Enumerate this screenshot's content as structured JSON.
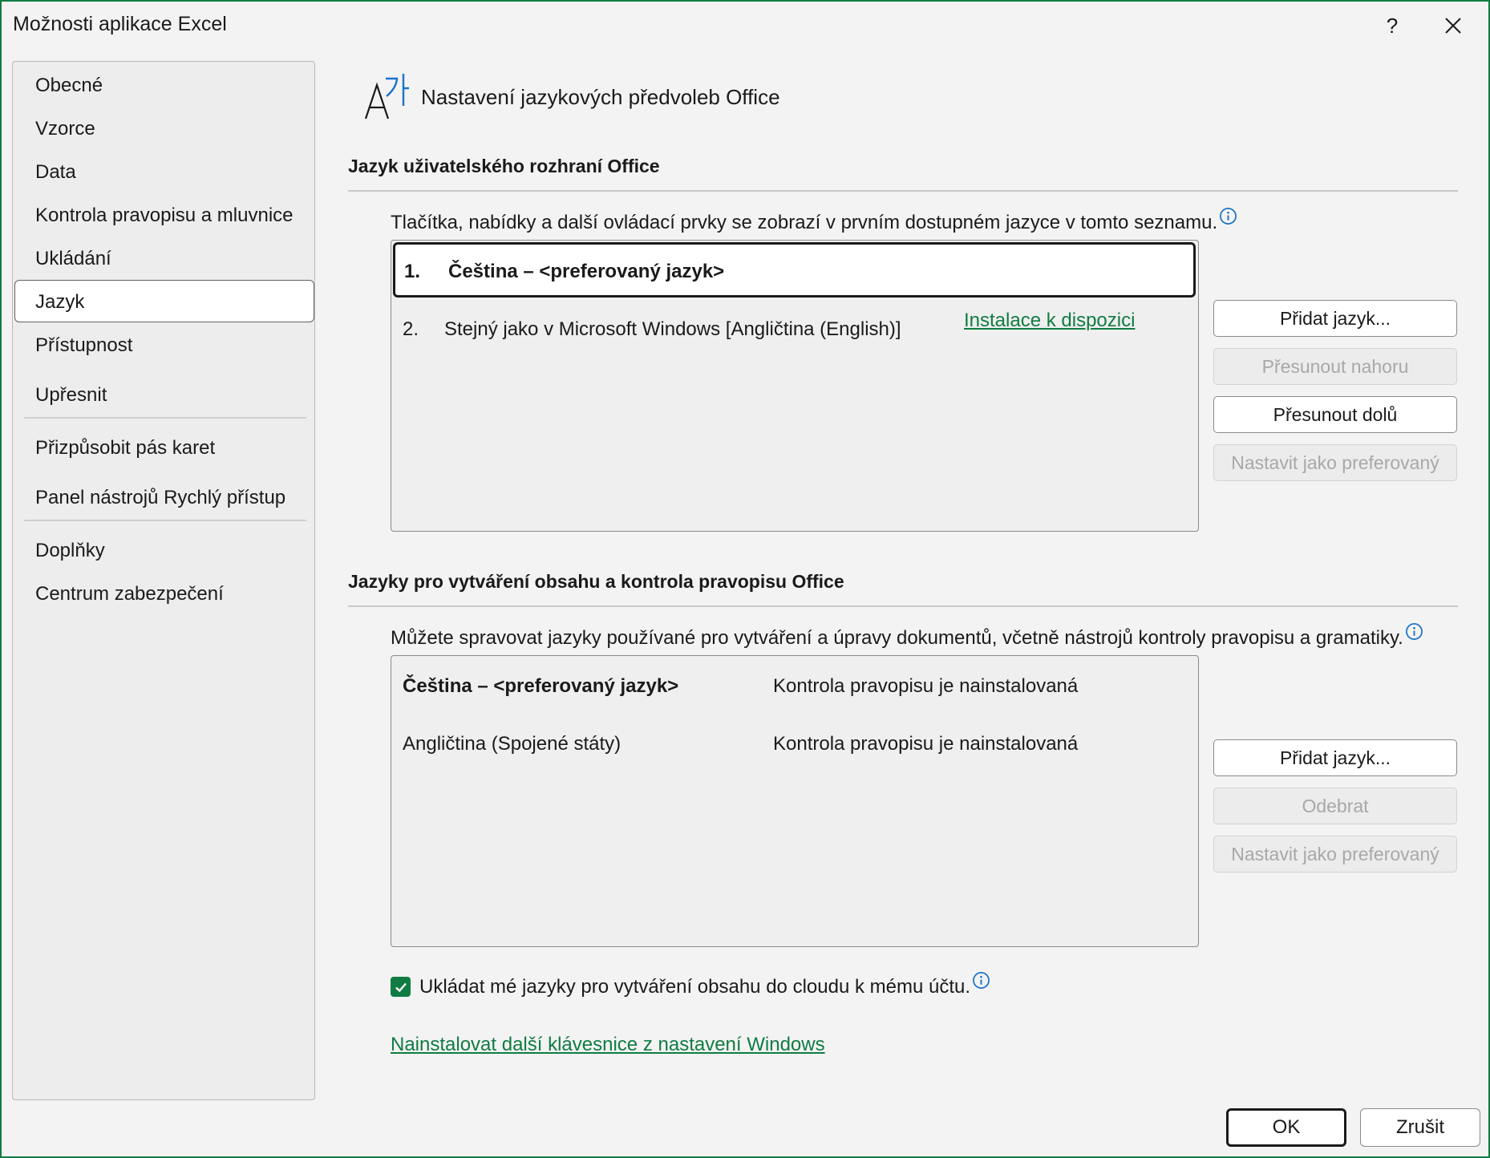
{
  "window": {
    "title": "Možnosti aplikace Excel",
    "help_glyph": "?",
    "close_glyph": "✕"
  },
  "sidebar": {
    "items": [
      {
        "label": "Obecné"
      },
      {
        "label": "Vzorce"
      },
      {
        "label": "Data"
      },
      {
        "label": "Kontrola pravopisu a mluvnice"
      },
      {
        "label": "Ukládání"
      },
      {
        "label": "Jazyk",
        "selected": true
      },
      {
        "label": "Přístupnost"
      },
      {
        "label": "Upřesnit"
      },
      {
        "label": "Přizpůsobit pás karet"
      },
      {
        "label": "Panel nástrojů Rychlý přístup"
      },
      {
        "label": "Doplňky"
      },
      {
        "label": "Centrum zabezpečení"
      }
    ]
  },
  "header": {
    "title": "Nastavení jazykových předvoleb Office",
    "icon": "language-icon"
  },
  "ui_language": {
    "section_title": "Jazyk uživatelského rozhraní Office",
    "description": "Tlačítka, nabídky a další ovládací prvky se zobrazí v prvním dostupném jazyce v tomto seznamu.",
    "rows": [
      {
        "num": "1.",
        "label": "Čeština – <preferovaný jazyk>",
        "selected": true
      },
      {
        "num": "2.",
        "label": "Stejný jako v Microsoft Windows [Angličtina (English)]",
        "link": "Instalace k dispozici"
      }
    ],
    "buttons": {
      "add": "Přidat jazyk...",
      "move_up": "Přesunout nahoru",
      "move_down": "Přesunout dolů",
      "set_preferred": "Nastavit jako preferovaný"
    }
  },
  "authoring": {
    "section_title": "Jazyky pro vytváření obsahu a kontrola pravopisu Office",
    "description": "Můžete spravovat jazyky používané pro vytváření a úpravy dokumentů, včetně nástrojů kontroly pravopisu a gramatiky.",
    "rows": [
      {
        "label": "Čeština – <preferovaný jazyk>",
        "status": "Kontrola pravopisu je nainstalovaná"
      },
      {
        "label": "Angličtina (Spojené státy)",
        "status": "Kontrola pravopisu je nainstalovaná"
      }
    ],
    "buttons": {
      "add": "Přidat jazyk...",
      "remove": "Odebrat",
      "set_preferred": "Nastavit jako preferovaný"
    },
    "cloud_checkbox": {
      "label": "Ukládat mé jazyky pro vytváření obsahu do cloudu k mému účtu.",
      "checked": true
    },
    "keyboard_link": "Nainstalovat další klávesnice z nastavení Windows"
  },
  "footer": {
    "ok": "OK",
    "cancel": "Zrušit"
  },
  "colors": {
    "accent": "#107c41",
    "info": "#1a73c8"
  }
}
